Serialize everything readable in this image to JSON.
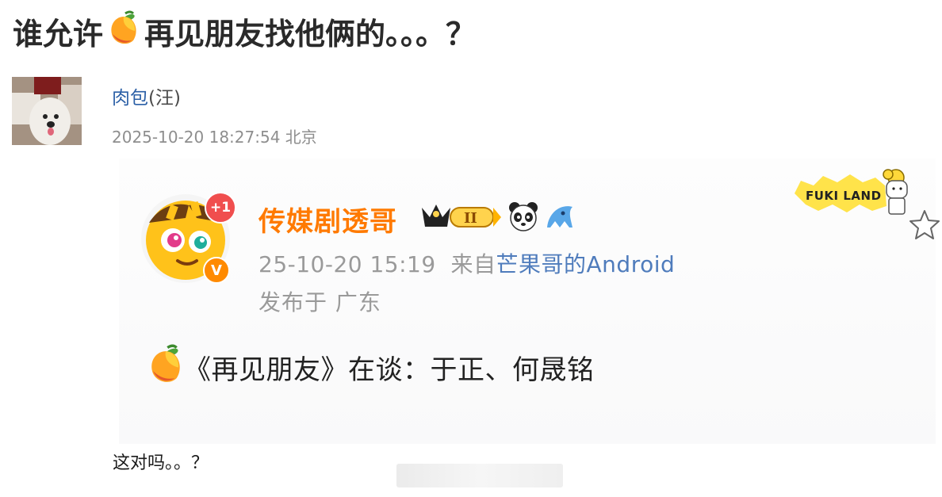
{
  "post": {
    "title_part1": "谁允许",
    "title_part2": "再见朋友找他俩的。。。？",
    "author_name": "肉包",
    "author_suffix": "(汪)",
    "timestamp": "2025-10-20 18:27:54 北京",
    "caption": "这对吗。。？"
  },
  "card": {
    "badge_count": "+1",
    "verified_mark": "V",
    "name": "传媒剧透哥",
    "level": "II",
    "time": "25-10-20 15:19",
    "source_prefix": "来自",
    "source_name": "芒果哥的Android",
    "location": "发布于 广东",
    "content": "《再见朋友》在谈：于正、何晟铭"
  },
  "sticker": {
    "text": "FUKI LAND"
  },
  "icons": [
    "mango-icon",
    "crown-level-icon",
    "panda-icon",
    "shark-icon",
    "star-icon"
  ],
  "colors": {
    "author_link": "#2b5fa6",
    "card_name": "#ff7a00",
    "source_link": "#4f7cbc",
    "meta_gray": "#8e8e8e"
  }
}
